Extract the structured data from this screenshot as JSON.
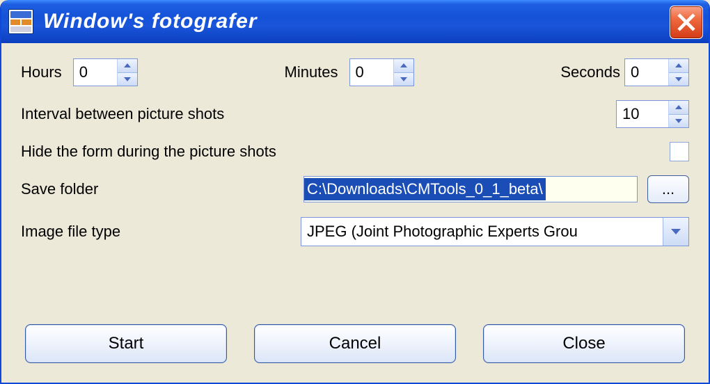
{
  "window": {
    "title": "Window's fotografer"
  },
  "time": {
    "hours_label": "Hours",
    "hours_value": "0",
    "minutes_label": "Minutes",
    "minutes_value": "0",
    "seconds_label": "Seconds",
    "seconds_value": "0"
  },
  "interval": {
    "label": "Interval between picture shots",
    "value": "10"
  },
  "hide_form": {
    "label": "Hide the form during the picture shots",
    "checked": false
  },
  "save_folder": {
    "label": "Save folder",
    "path": "C:\\Downloads\\CMTools_0_1_beta\\",
    "browse_label": "..."
  },
  "image_type": {
    "label": "Image file type",
    "selected": "JPEG (Joint Photographic Experts Grou"
  },
  "buttons": {
    "start": "Start",
    "cancel": "Cancel",
    "close": "Close"
  }
}
